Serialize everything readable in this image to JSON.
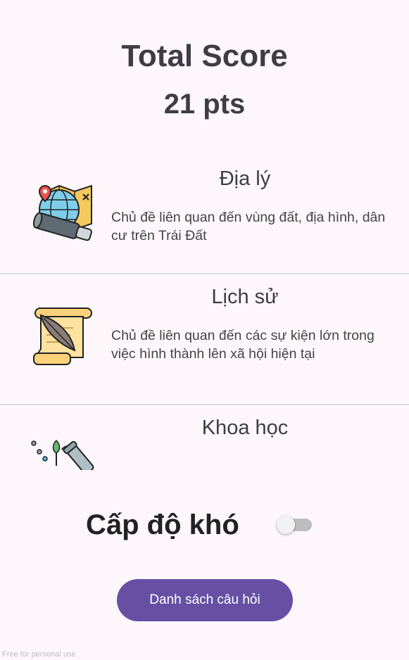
{
  "header": {
    "title": "Total Score",
    "score": "21 pts"
  },
  "topics": [
    {
      "title": "Địa lý",
      "description": "Chủ đề liên quan đến vùng đất, địa hình, dân cư trên Trái Đất",
      "icon": "geography-icon"
    },
    {
      "title": "Lịch sử",
      "description": "Chủ đề liên quan đến các sự kiện lớn trong việc hình thành lên xã hội hiện tại",
      "icon": "history-scroll-icon"
    },
    {
      "title": "Khoa học",
      "description": "",
      "icon": "science-icon"
    }
  ],
  "difficulty": {
    "label": "Cấp độ khó",
    "enabled": false
  },
  "question_list_button": "Danh sách câu hỏi",
  "watermark": "Free for personal use",
  "colors": {
    "accent": "#6750a4",
    "background": "#fdf7fc"
  }
}
